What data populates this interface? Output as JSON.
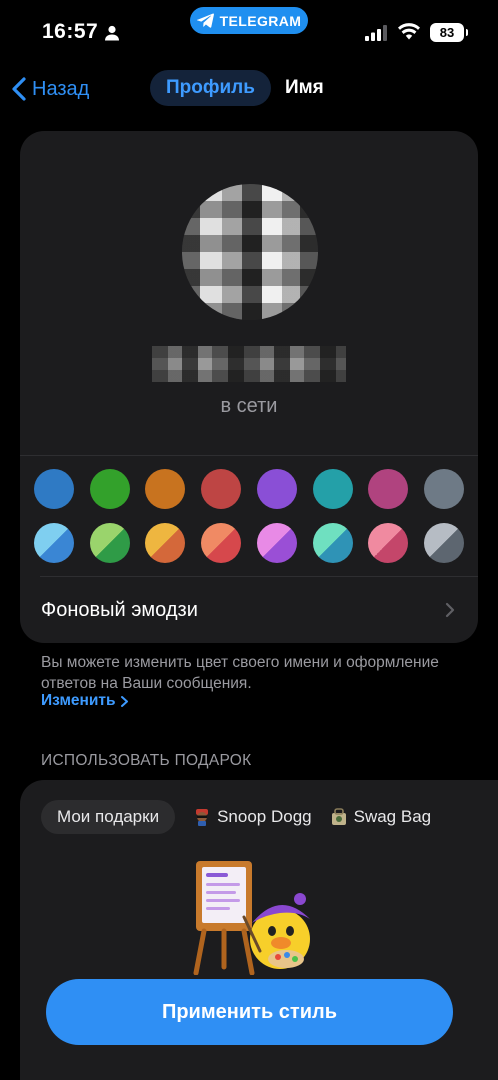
{
  "status_bar": {
    "time": "16:57",
    "app_pill": "TELEGRAM",
    "battery": "83"
  },
  "nav": {
    "back_label": "Назад",
    "segments": [
      {
        "label": "Профиль"
      },
      {
        "label": "Имя"
      }
    ]
  },
  "profile": {
    "status": "в сети",
    "colors_row1": [
      "#2f7ac4",
      "#33a12b",
      "#c8731f",
      "#be4544",
      "#8a4fd6",
      "#24a0a8",
      "#b0437f",
      "#6e7a86"
    ],
    "colors_row2": [
      [
        "#7fcff0",
        "#3a86d4"
      ],
      [
        "#9ad46c",
        "#2f9b47"
      ],
      [
        "#eeb640",
        "#d4683a"
      ],
      [
        "#f08a64",
        "#d6484c"
      ],
      [
        "#e88ae6",
        "#9a4fd6"
      ],
      [
        "#6fe0c0",
        "#2f93b6"
      ],
      [
        "#f08aa0",
        "#c4466a"
      ],
      [
        "#b6bcc4",
        "#5d6670"
      ]
    ],
    "background_emoji_label": "Фоновый эмодзи"
  },
  "hint": {
    "text": "Вы можете изменить цвет своего имени и оформление ответов на Ваши сообщения.",
    "link": "Изменить"
  },
  "gift_section": {
    "title": "ИСПОЛЬЗОВАТЬ ПОДАРОК",
    "tabs": [
      {
        "label": "Мои подарки"
      },
      {
        "label": "Snoop Dogg"
      },
      {
        "label": "Swag Bag"
      }
    ]
  },
  "apply_button": "Применить стиль"
}
